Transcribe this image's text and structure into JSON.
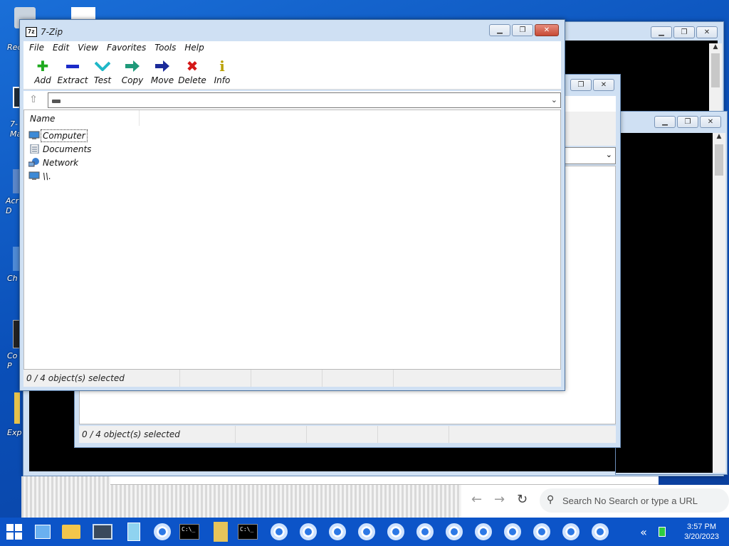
{
  "desktop": {
    "icons": [
      {
        "label": "Rec",
        "color": "#c9d3de"
      },
      {
        "label": "7-\nMa",
        "color": "#1f2c3a"
      },
      {
        "label": "Acr\nD",
        "color": "#5b87c9"
      },
      {
        "label": "Ch",
        "color": "#4f8bd6"
      },
      {
        "label": "Co\nP",
        "color": "#222222"
      },
      {
        "label": "Exp",
        "color": "#e6c24b"
      }
    ]
  },
  "main_window": {
    "title": "7-Zip",
    "app_icon_text": "7z",
    "menu": [
      "File",
      "Edit",
      "View",
      "Favorites",
      "Tools",
      "Help"
    ],
    "toolbar": [
      {
        "label": "Add",
        "icon": "plus-icon",
        "glyph": "✚",
        "color": "#1faa1f"
      },
      {
        "label": "Extract",
        "icon": "minus-icon",
        "glyph": "▬",
        "color": "#1b2bc8"
      },
      {
        "label": "Test",
        "icon": "check-chevron-icon",
        "glyph": "⌄",
        "color": "#1fb8c8"
      },
      {
        "label": "Copy",
        "icon": "copy-arrow-icon",
        "glyph": "➡",
        "color": "#1f9a7a"
      },
      {
        "label": "Move",
        "icon": "move-arrow-icon",
        "glyph": "➡",
        "color": "#1b2b9a"
      },
      {
        "label": "Delete",
        "icon": "delete-x-icon",
        "glyph": "✖",
        "color": "#d41818"
      },
      {
        "label": "Info",
        "icon": "info-icon",
        "glyph": "ℹ",
        "color": "#b9a000"
      }
    ],
    "column_header": "Name",
    "items": [
      {
        "name": "Computer",
        "icon": "computer-icon"
      },
      {
        "name": "Documents",
        "icon": "documents-icon"
      },
      {
        "name": "Network",
        "icon": "network-icon"
      },
      {
        "name": "\\\\.",
        "icon": "computer-icon"
      }
    ],
    "status": "0 / 4 object(s) selected"
  },
  "middle_window": {
    "status": "0 / 4 object(s) selected"
  },
  "browser": {
    "search_placeholder": "Search No Search or type a URL"
  },
  "taskbar": {
    "time": "3:57 PM",
    "date": "3/20/2023",
    "cmd_text": "C:\\_"
  }
}
